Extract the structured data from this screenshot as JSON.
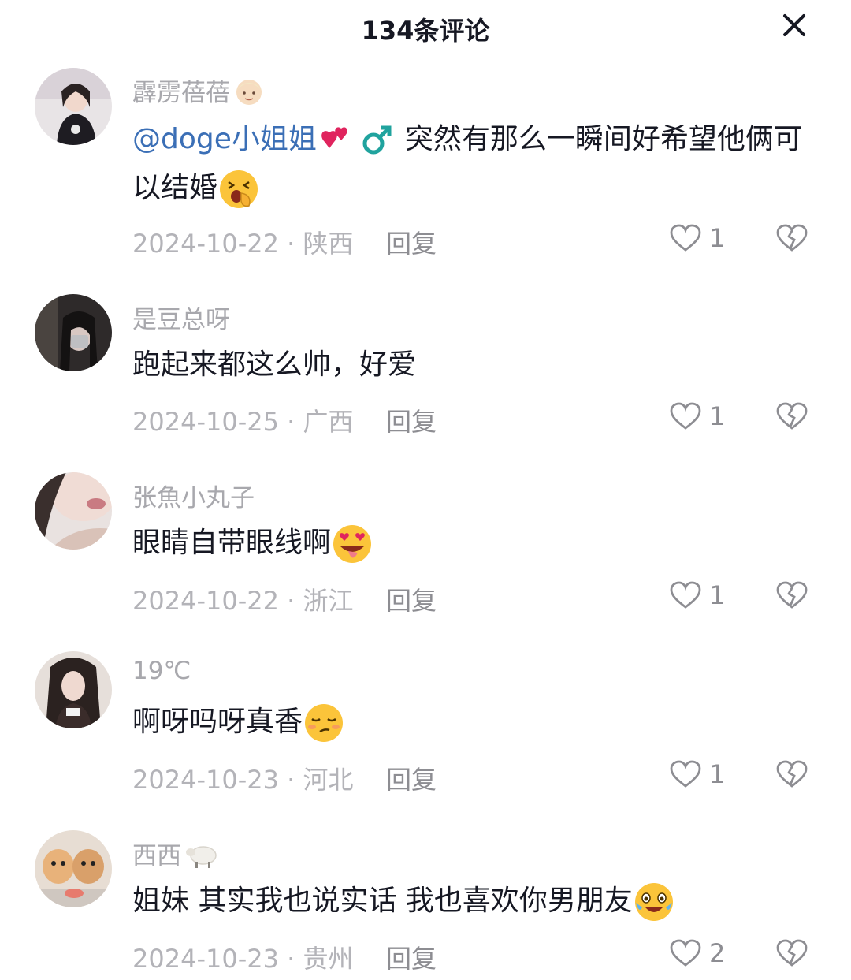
{
  "header": {
    "title": "134条评论",
    "close_icon": "close-icon"
  },
  "reply_label": "回复",
  "comments": [
    {
      "username": "霹雳蓓蓓",
      "username_emoji": "baby-face-emoji",
      "mention": "@doge小姐姐",
      "mention_emojis": [
        "two-hearts-emoji",
        "male-sign-emoji"
      ],
      "text": "突然有那么一瞬间好希望他俩可以结婚",
      "text_emoji": "yawning-face-emoji",
      "date": "2024-10-22",
      "location": "陕西",
      "likes": "1"
    },
    {
      "username": "是豆总呀",
      "text": "跑起来都这么帅，好爱",
      "date": "2024-10-25",
      "location": "广西",
      "likes": "1"
    },
    {
      "username": "张魚小丸子",
      "text": "眼睛自带眼线啊",
      "text_emoji": "heart-eyes-tongue-emoji",
      "date": "2024-10-22",
      "location": "浙江",
      "likes": "1"
    },
    {
      "username": "19℃",
      "text": "啊呀吗呀真香",
      "text_emoji": "smug-face-emoji",
      "date": "2024-10-23",
      "location": "河北",
      "likes": "1"
    },
    {
      "username": "西西",
      "username_emoji": "sheep-emoji",
      "text": "姐妹 其实我也说实话 我也喜欢你男朋友",
      "text_emoji": "crying-laughing-emoji",
      "date": "2024-10-23",
      "location": "贵州",
      "likes": "2"
    }
  ],
  "colors": {
    "text": "#161823",
    "secondary": "#a8a8ad",
    "mention": "#3b6fb6",
    "heart_emoji": "#e0245e"
  }
}
